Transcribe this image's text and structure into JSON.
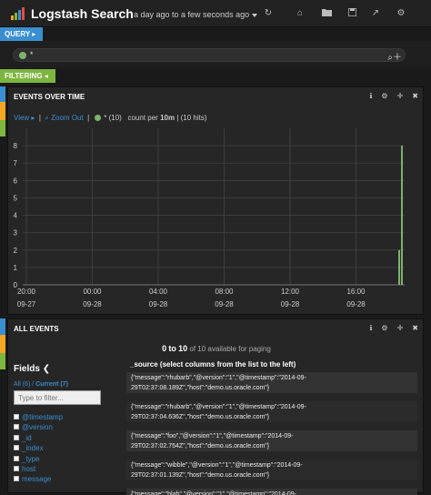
{
  "header": {
    "title": "Logstash Search",
    "timepicker": "a day ago to a few seconds ago"
  },
  "query": {
    "tab_label": "QUERY",
    "value": "*"
  },
  "filter": {
    "tab_label": "FILTERING"
  },
  "events_panel": {
    "title": "EVENTS OVER TIME",
    "view_label": "View",
    "zoom_out_label": "Zoom Out",
    "legend_label": "* (10)",
    "count_per_label": "count per",
    "interval": "10m",
    "hits": "(10 hits)"
  },
  "chart_data": {
    "type": "bar",
    "title": "",
    "xlabel": "",
    "ylabel": "",
    "ylim": [
      0,
      9
    ],
    "yticks": [
      0,
      1,
      2,
      3,
      4,
      5,
      6,
      7,
      8
    ],
    "x_ticks": [
      {
        "time": "20:00",
        "date": "09-27"
      },
      {
        "time": "00:00",
        "date": "09-28"
      },
      {
        "time": "04:00",
        "date": "09-28"
      },
      {
        "time": "08:00",
        "date": "09-28"
      },
      {
        "time": "12:00",
        "date": "09-28"
      },
      {
        "time": "16:00",
        "date": "09-28"
      }
    ],
    "series": [
      {
        "name": "*",
        "color": "#7eb26d",
        "values": [
          2,
          8
        ]
      }
    ],
    "grid": true
  },
  "all_events": {
    "title": "ALL EVENTS",
    "page_start": "0",
    "page_end": "10",
    "page_total_text": "of 10 available for paging",
    "fields_title": "Fields",
    "all_link": "All (6)",
    "current_link": "Current (7)",
    "filter_placeholder": "Type to filter...",
    "source_header": "_source (select columns from the list to the left)",
    "fields": [
      "@timestamp",
      "@version",
      "_id",
      "_index",
      "_type",
      "host",
      "message"
    ],
    "docs": [
      "{\"message\":\"rhubarb\",\"@version\":\"1\",\"@timestamp\":\"2014-09-29T02:37:08.189Z\",\"host\":\"demo.us.oracle.com\"}",
      "{\"message\":\"rhubarb\",\"@version\":\"1\",\"@timestamp\":\"2014-09-29T02:37:04.636Z\",\"host\":\"demo.us.oracle.com\"}",
      "{\"message\":\"foo\",\"@version\":\"1\",\"@timestamp\":\"2014-09-29T02:37:02.754Z\",\"host\":\"demo.us.oracle.com\"}",
      "{\"message\":\"wibble\",\"@version\":\"1\",\"@timestamp\":\"2014-09-29T02:37:01.139Z\",\"host\":\"demo.us.oracle.com\"}",
      "{\"message\":\"blah\",\"@version\":\"1\",\"@timestamp\":\"2014-09-"
    ]
  }
}
